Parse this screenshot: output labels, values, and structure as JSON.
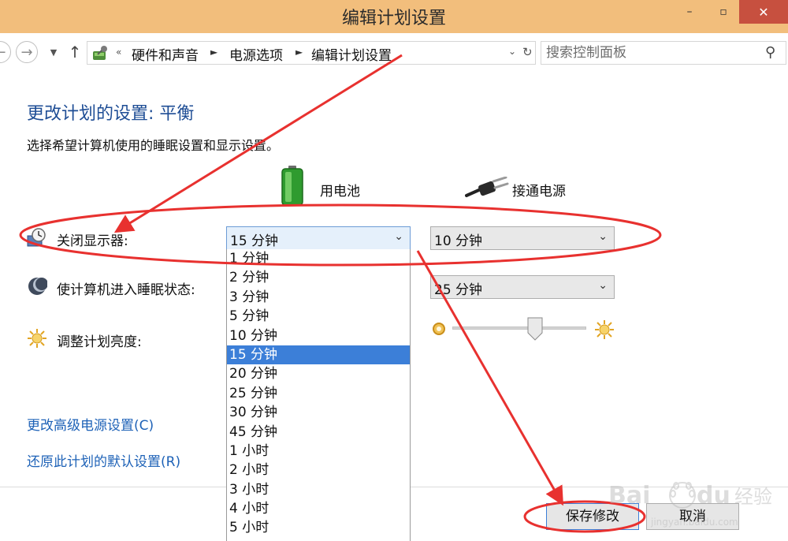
{
  "window": {
    "title": "编辑计划设置",
    "min_glyph": "–",
    "max_glyph": "▫",
    "close_glyph": "✕"
  },
  "nav": {
    "back_glyph": "←",
    "forward_glyph": "→",
    "recent_glyph": "▼",
    "up_glyph": "↑",
    "breadcrumb_overflow": "«",
    "breadcrumbs": [
      "硬件和声音",
      "电源选项",
      "编辑计划设置"
    ],
    "separator": "►",
    "dropdown_glyph": "⌄",
    "refresh_glyph": "↻",
    "search_placeholder": "搜索控制面板",
    "search_glyph": "⚲"
  },
  "page": {
    "title": "更改计划的设置: 平衡",
    "description": "选择希望计算机使用的睡眠设置和显示设置。",
    "columns": {
      "battery": "用电池",
      "plugged_in": "接通电源"
    }
  },
  "settings": {
    "display_off": {
      "label": "关闭显示器:",
      "battery_value": "15 分钟",
      "plugged_value": "10 分钟"
    },
    "sleep": {
      "label": "使计算机进入睡眠状态:",
      "plugged_value": "25 分钟"
    },
    "brightness": {
      "label": "调整计划亮度:",
      "plugged_level": 0.62
    }
  },
  "dropdown": {
    "options": [
      "1 分钟",
      "2 分钟",
      "3 分钟",
      "5 分钟",
      "10 分钟",
      "15 分钟",
      "20 分钟",
      "25 分钟",
      "30 分钟",
      "45 分钟",
      "1 小时",
      "2 小时",
      "3 小时",
      "4 小时",
      "5 小时"
    ],
    "selected_index": 5
  },
  "links": {
    "advanced": "更改高级电源设置(C)",
    "restore": "还原此计划的默认设置(R)"
  },
  "buttons": {
    "save": "保存修改",
    "cancel": "取消",
    "chevron": "⌄"
  },
  "colors": {
    "titlebar": "#f2be7c",
    "title_text": "#1e4d95",
    "link": "#1e62b7",
    "selection": "#3c7fd8",
    "annotation": "#e8312f"
  },
  "watermark": {
    "text": "Bai du 经验",
    "sub": "jingyan.baidu.com"
  }
}
